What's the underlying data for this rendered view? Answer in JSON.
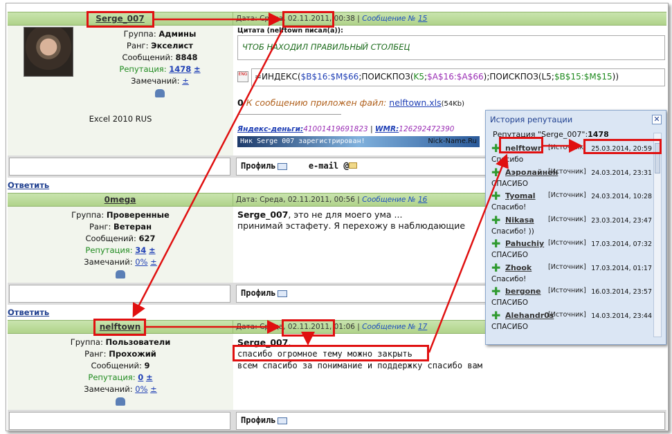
{
  "posts": [
    {
      "nick": "Serge_007",
      "group_label": "Группа:",
      "group": "Админы",
      "rank_label": "Ранг:",
      "rank": "Экселист",
      "msgs_label": "Сообщений:",
      "msgs": "8848",
      "rep_label": "Репутация:",
      "rep": "1478",
      "rep_pm": "±",
      "zam_label": "Замечаний:",
      "zam": "±",
      "extra": "Excel 2010 RUS",
      "meta_date": "Дата: Среда, 02.11.2011, 00:38",
      "meta_sep": "|",
      "meta_msg_label": "Сообщение №",
      "meta_msg_num": "15",
      "quote_label": "Цитата (nelftown писал(а)):",
      "quote_text": "ЧТОБ НАХОДИЛ ПРАВИЛЬНЫЙ СТОЛБЕЦ",
      "lang_badge": "ENG",
      "formula": {
        "pre": "=ИНДЕКС(",
        "r1": "$B$16:$M$66",
        "m1": ";ПОИСКПОЗ(",
        "r2": "K5",
        "m2": ";",
        "r3": "$A$16:$A$66",
        "m3": ");ПОИСКПОЗ(L5;",
        "r4": "$B$15:$M$15",
        "post": "))"
      },
      "attach_label": "К сообщению приложен файл:",
      "attach_file": "nelftown.xls",
      "attach_size": "(54Kb)",
      "sig_yandex_label": "Яндекс-деньги:",
      "sig_yandex": "41001419691823",
      "sig_sep": "|",
      "sig_wmr_label": "WMR:",
      "sig_wmr": "126292472390",
      "banner_text": "Ник Serge 007 зарегистрирован!",
      "banner_site": "Nick-Name.Ru",
      "footer_profile": "Профиль",
      "footer_email": "e-mail",
      "reply": "Ответить"
    },
    {
      "nick": "0mega",
      "group_label": "Группа:",
      "group": "Проверенные",
      "rank_label": "Ранг:",
      "rank": "Ветеран",
      "msgs_label": "Сообщений:",
      "msgs": "627",
      "rep_label": "Репутация:",
      "rep": "34",
      "rep_pm": "±",
      "zam_label": "Замечаний:",
      "zam": "0%",
      "zam_pm": "±",
      "meta_date": "Дата: Среда, 02.11.2011, 00:56",
      "meta_sep": "|",
      "meta_msg_label": "Сообщение №",
      "meta_msg_num": "16",
      "line1_nick": "Serge_007",
      "line1_rest": ", это не для моего ума ...",
      "line2": "принимай эстафету. Я перехожу в наблюдающие",
      "footer_profile": "Профиль",
      "reply": "Ответить"
    },
    {
      "nick": "nelftown",
      "group_label": "Группа:",
      "group": "Пользователи",
      "rank_label": "Ранг:",
      "rank": "Прохожий",
      "msgs_label": "Сообщений:",
      "msgs": "9",
      "rep_label": "Репутация:",
      "rep": "0",
      "rep_pm": "±",
      "zam_label": "Замечаний:",
      "zam": "0%",
      "zam_pm": "±",
      "meta_date": "Дата: Среда, 02.11.2011, 01:06",
      "meta_sep": "|",
      "meta_msg_label": "Сообщение №",
      "meta_msg_num": "17",
      "line1_nick": "Serge_007",
      "line1_rest": ",",
      "line2": "спасибо огромное тему можно закрыть",
      "line3": "всем спасибо за понимание и поддержку спасибо вам",
      "footer_profile": "Профиль"
    }
  ],
  "popup": {
    "title": "История репутации",
    "close": "✕",
    "header_label": "Репутация \"Serge_007\":",
    "header_value": "1478",
    "source_label": "[Источник]",
    "entries": [
      {
        "user": "nelftown",
        "date": "25.03.2014, 20:59",
        "text": "Спасибо"
      },
      {
        "user": "Аэролайнен",
        "date": "24.03.2014, 23:31",
        "text": "СПАСИБО"
      },
      {
        "user": "Tyomal",
        "date": "24.03.2014, 10:28",
        "text": "Спасибо!"
      },
      {
        "user": "Nikasa",
        "date": "23.03.2014, 23:47",
        "text": "Спасибо! ))"
      },
      {
        "user": "Pahuchiy",
        "date": "17.03.2014, 07:32",
        "text": "СПАСИБО"
      },
      {
        "user": "Zhook",
        "date": "17.03.2014, 01:17",
        "text": "Спасибо!"
      },
      {
        "user": "bergone",
        "date": "16.03.2014, 23:57",
        "text": "СПАСИБО"
      },
      {
        "user": "Alehandr0s",
        "date": "14.03.2014, 23:44",
        "text": "СПАСИБО"
      }
    ]
  },
  "colors": {
    "highlight": "#e01010",
    "header_green": "#b0d38a",
    "link_blue": "#1f3fb5"
  }
}
